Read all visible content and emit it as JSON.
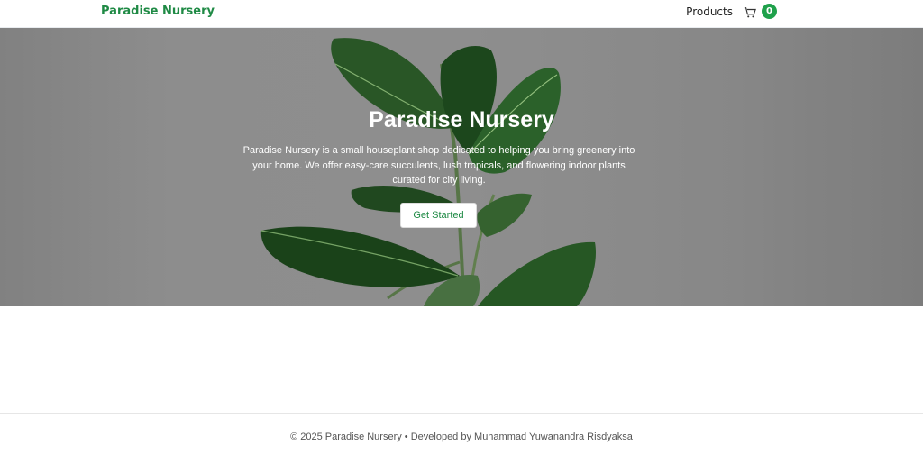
{
  "navbar": {
    "brand": "Paradise Nursery",
    "products_label": "Products",
    "cart_count": "0"
  },
  "hero": {
    "title": "Paradise Nursery",
    "description": "Paradise Nursery is a small houseplant shop dedicated to helping you bring greenery into your home. We offer easy-care succulents, lush tropicals, and flowering indoor plants curated for city living.",
    "cta_label": "Get Started"
  },
  "footer": {
    "text": "© 2025 Paradise Nursery • Developed by Muhammad Yuwanandra Risdyaksa"
  },
  "colors": {
    "brand_green": "#1f8a45",
    "badge_green": "#1fa14b",
    "hero_gray": "#9a9a9a"
  },
  "icons": {
    "cart": "shopping-cart-icon"
  }
}
